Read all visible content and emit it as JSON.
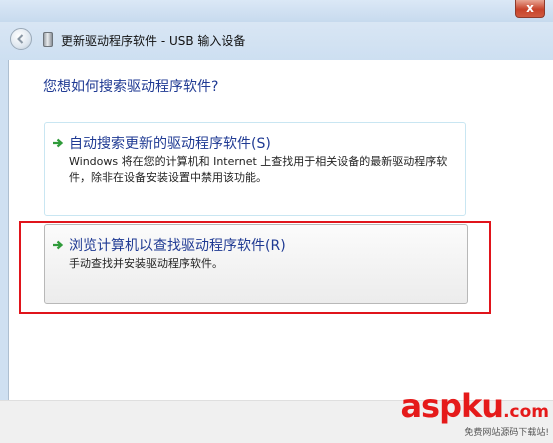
{
  "window": {
    "title": "更新驱动程序软件 - USB 输入设备",
    "close_label": "x"
  },
  "main": {
    "question": "您想如何搜索驱动程序软件?",
    "options": [
      {
        "title": "自动搜索更新的驱动程序软件(S)",
        "description": "Windows 将在您的计算机和 Internet 上查找用于相关设备的最新驱动程序软件，除非在设备安装设置中禁用该功能。"
      },
      {
        "title": "浏览计算机以查找驱动程序软件(R)",
        "description": "手动查找并安装驱动程序软件。"
      }
    ]
  },
  "watermark": {
    "main": "aspku",
    "suffix": ".com",
    "sub": "免费网站源码下载站!"
  },
  "colors": {
    "link_blue": "#1f3a93",
    "arrow_green": "#2f9b3a",
    "highlight_red": "#e0141b"
  }
}
